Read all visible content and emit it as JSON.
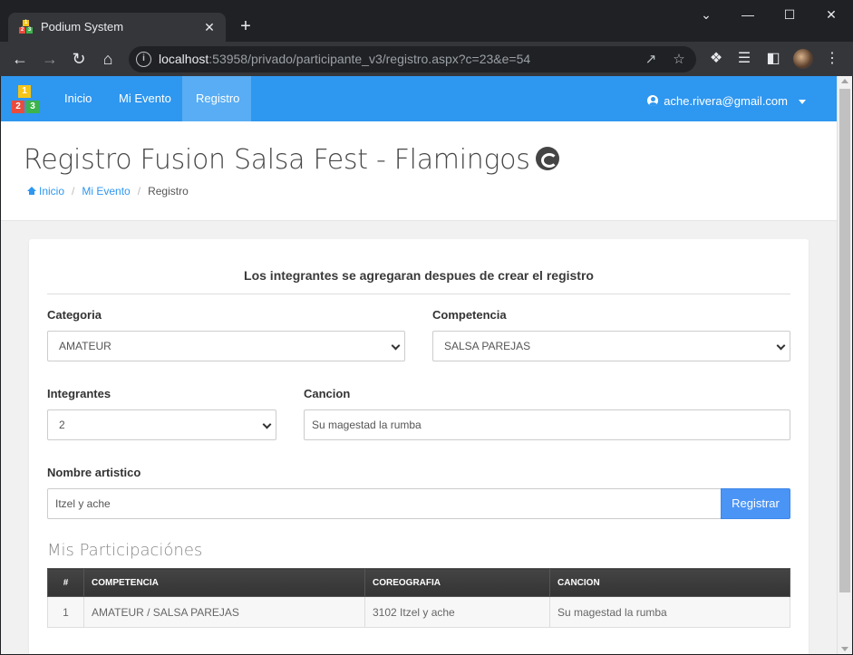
{
  "browser": {
    "tab_title": "Podium System",
    "tab_close": "✕",
    "new_tab": "+",
    "url_host": "localhost",
    "url_rest": ":53958/privado/participante_v3/registro.aspx?c=23&e=54",
    "controls": {
      "minimize": "—",
      "maximize": "☐",
      "close": "✕",
      "dropdown": "⌄"
    }
  },
  "nav": {
    "logo_digits": [
      "1",
      "2",
      "3"
    ],
    "items": [
      {
        "label": "Inicio"
      },
      {
        "label": "Mi Evento"
      },
      {
        "label": "Registro",
        "active": true
      }
    ],
    "user_email": "ache.rivera@gmail.com",
    "accent_color": "#2e97f0"
  },
  "header": {
    "title": "Registro Fusion Salsa Fest - Flamingos",
    "breadcrumb": [
      {
        "label": "Inicio",
        "link": true
      },
      {
        "label": "Mi Evento",
        "link": true
      },
      {
        "label": "Registro",
        "link": false
      }
    ]
  },
  "form": {
    "notice": "Los integrantes se agregaran despues de crear el registro",
    "categoria": {
      "label": "Categoria",
      "value": "AMATEUR"
    },
    "competencia": {
      "label": "Competencia",
      "value": "SALSA PAREJAS"
    },
    "integrantes": {
      "label": "Integrantes",
      "value": "2"
    },
    "cancion": {
      "label": "Cancion",
      "value": "Su magestad la rumba"
    },
    "nombre_artistico": {
      "label": "Nombre artistico",
      "value": "Itzel y ache"
    },
    "submit_label": "Registrar"
  },
  "participaciones": {
    "title": "Mis Participaciónes",
    "columns": [
      "#",
      "COMPETENCIA",
      "COREOGRAFIA",
      "CANCION"
    ],
    "rows": [
      [
        "1",
        "AMATEUR / SALSA PAREJAS",
        "3102 Itzel y ache",
        "Su magestad la rumba"
      ]
    ]
  }
}
